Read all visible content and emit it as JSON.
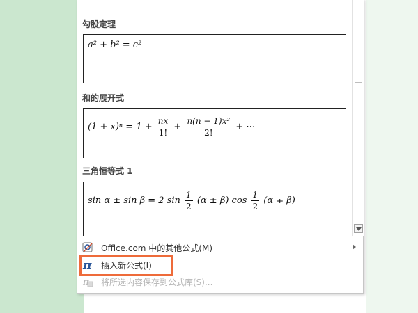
{
  "gallery": {
    "sections": [
      {
        "title": "勾股定理",
        "formula": "a² + b² = c²"
      },
      {
        "title": "和的展开式",
        "formula_parts": {
          "lhs": "(1 + x)ⁿ = 1 + ",
          "f1_num": "nx",
          "f1_den": "1!",
          "plus": "+",
          "f2_num": "n(n − 1)x²",
          "f2_den": "2!",
          "tail": "+ ⋯"
        }
      },
      {
        "title": "三角恒等式 1",
        "formula_parts": {
          "lhs": "sin α ± sin β = 2 sin",
          "f1_num": "1",
          "f1_den": "2",
          "mid1": "(α ± β) cos",
          "f2_num": "1",
          "f2_den": "2",
          "mid2": "(α ∓ β)"
        }
      }
    ]
  },
  "menu": {
    "items": [
      {
        "label": "Office.com 中的其他公式(M)",
        "icon": "office-icon",
        "has_submenu": true,
        "enabled": true
      },
      {
        "label": "插入新公式(I)",
        "icon": "pi-icon",
        "has_submenu": false,
        "enabled": true
      },
      {
        "label": "将所选内容保存到公式库(S)...",
        "icon": "save-equation-icon",
        "has_submenu": false,
        "enabled": false
      }
    ]
  },
  "colors": {
    "highlight": "#ee6b3a",
    "doc_bg": "#cbe7cf",
    "accent": "#2b579a"
  }
}
